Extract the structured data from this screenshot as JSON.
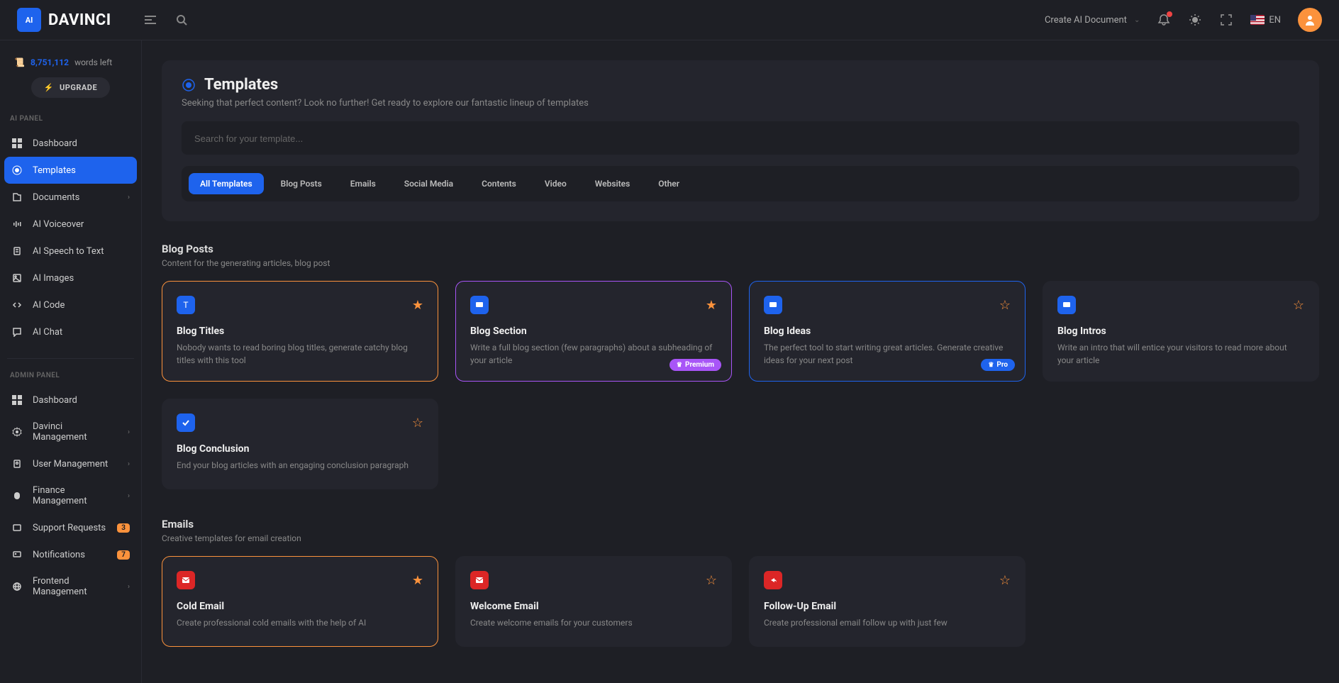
{
  "header": {
    "logo_text": "DAVINCI",
    "create_doc": "Create AI Document",
    "language": "EN"
  },
  "sidebar": {
    "words_count": "8,751,112",
    "words_label": "words left",
    "upgrade": "UPGRADE",
    "ai_panel_label": "AI PANEL",
    "admin_panel_label": "ADMIN PANEL",
    "ai_items": [
      {
        "label": "Dashboard"
      },
      {
        "label": "Templates"
      },
      {
        "label": "Documents"
      },
      {
        "label": "AI Voiceover"
      },
      {
        "label": "AI Speech to Text"
      },
      {
        "label": "AI Images"
      },
      {
        "label": "AI Code"
      },
      {
        "label": "AI Chat"
      }
    ],
    "admin_items": [
      {
        "label": "Dashboard"
      },
      {
        "label": "Davinci Management"
      },
      {
        "label": "User Management"
      },
      {
        "label": "Finance Management"
      },
      {
        "label": "Support Requests",
        "badge": "3"
      },
      {
        "label": "Notifications",
        "badge": "7"
      },
      {
        "label": "Frontend Management"
      }
    ]
  },
  "page": {
    "title": "Templates",
    "subtitle": "Seeking that perfect content? Look no further! Get ready to explore our fantastic lineup of templates",
    "search_placeholder": "Search for your template...",
    "filters": [
      "All Templates",
      "Blog Posts",
      "Emails",
      "Social Media",
      "Contents",
      "Video",
      "Websites",
      "Other"
    ]
  },
  "categories": [
    {
      "title": "Blog Posts",
      "subtitle": "Content for the generating articles, blog post",
      "cards": [
        {
          "title": "Blog Titles",
          "desc": "Nobody wants to read boring blog titles, generate catchy blog titles with this tool",
          "border": "orange",
          "star": "filled",
          "icon": "T",
          "icon_bg": "blue"
        },
        {
          "title": "Blog Section",
          "desc": "Write a full blog section (few paragraphs) about a subheading of your article",
          "border": "purple",
          "star": "filled",
          "badge": "Premium",
          "badge_type": "premium",
          "icon": "chat",
          "icon_bg": "blue"
        },
        {
          "title": "Blog Ideas",
          "desc": "The perfect tool to start writing great articles. Generate creative ideas for your next post",
          "border": "blue",
          "star": "empty-orange",
          "badge": "Pro",
          "badge_type": "pro",
          "icon": "chat",
          "icon_bg": "blue"
        },
        {
          "title": "Blog Intros",
          "desc": "Write an intro that will entice your visitors to read more about your article",
          "border": "none",
          "star": "empty-orange",
          "icon": "chat",
          "icon_bg": "blue"
        },
        {
          "title": "Blog Conclusion",
          "desc": "End your blog articles with an engaging conclusion paragraph",
          "border": "none",
          "star": "empty-orange",
          "icon": "check",
          "icon_bg": "blue"
        }
      ]
    },
    {
      "title": "Emails",
      "subtitle": "Creative templates for email creation",
      "cards": [
        {
          "title": "Cold Email",
          "desc": "Create professional cold emails with the help of AI",
          "border": "orange",
          "star": "filled",
          "icon": "mail",
          "icon_bg": "red"
        },
        {
          "title": "Welcome Email",
          "desc": "Create welcome emails for your customers",
          "border": "none",
          "star": "empty-orange",
          "icon": "mail",
          "icon_bg": "red"
        },
        {
          "title": "Follow-Up Email",
          "desc": "Create professional email follow up with just few",
          "border": "none",
          "star": "empty-orange",
          "icon": "reply",
          "icon_bg": "red"
        }
      ]
    }
  ]
}
